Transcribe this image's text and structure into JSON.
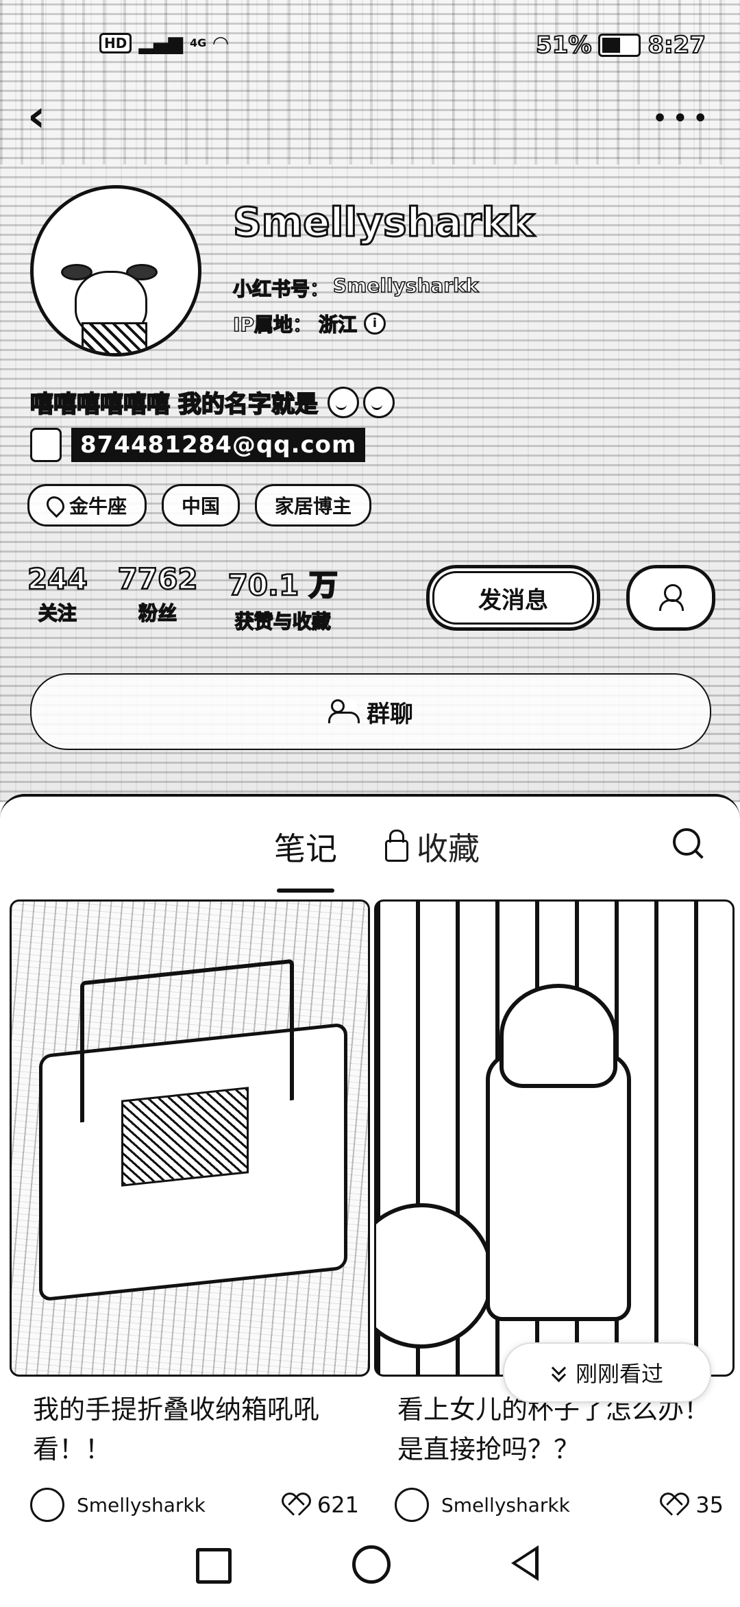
{
  "status_bar": {
    "hd_label": "HD",
    "network_label": "4G",
    "battery_percent": "51%",
    "time": "8:27"
  },
  "profile": {
    "name": "Smellysharkk",
    "id_label": "小红书号：",
    "id_value": "Smellysharkk",
    "ip_label": "IP属地：",
    "ip_value": "浙江",
    "bio": "嘻嘻嘻嘻嘻嘻 我的名字就是",
    "contact": "874481284@qq.com",
    "tags": [
      "金牛座",
      "中国",
      "家居博主"
    ]
  },
  "stats": [
    {
      "value": "244",
      "label": "关注"
    },
    {
      "value": "7762",
      "label": "粉丝"
    },
    {
      "value": "70.1 万",
      "label": "获赞与收藏"
    }
  ],
  "buttons": {
    "message": "发消息",
    "group_chat": "群聊"
  },
  "tabs": {
    "notes": "笔记",
    "favorites": "收藏"
  },
  "notes": [
    {
      "title": "我的手提折叠收纳箱吼吼看！！",
      "author": "Smellysharkk",
      "likes": "621"
    },
    {
      "title": "看上女儿的杯子了怎么办！是直接抢吗？？",
      "author": "Smellysharkk",
      "likes": "35"
    }
  ],
  "recent_pill": "刚刚看过"
}
